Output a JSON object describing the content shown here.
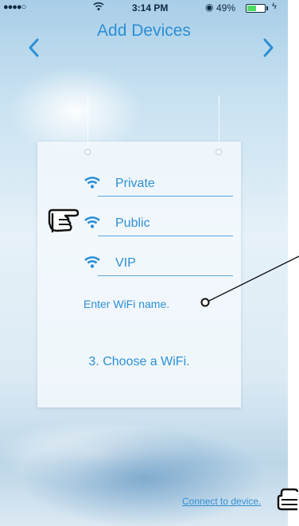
{
  "status_bar": {
    "signal": "●●●●○",
    "time": "3:14 PM",
    "battery_percent": "49%",
    "battery_level": 0.49,
    "battery_fill_color": "#4cd964"
  },
  "navbar": {
    "title": "Add Devices",
    "back_icon": "chevron-left-icon",
    "next_icon": "chevron-right-icon"
  },
  "networks": [
    {
      "label": "Private",
      "icon": "wifi-icon"
    },
    {
      "label": "Public",
      "icon": "wifi-icon"
    },
    {
      "label": "VIP",
      "icon": "wifi-icon"
    }
  ],
  "wifi_name_field": {
    "placeholder": "Enter WiFi name."
  },
  "step_text": "3. Choose a WiFi.",
  "connect_link": "Connect to device.",
  "annotations": {
    "pointer_icon": "pointing-hand-icon",
    "callout_icon": "callout-line-icon"
  },
  "colors": {
    "accent": "#2d8fd5",
    "status_text": "#0d2940"
  }
}
